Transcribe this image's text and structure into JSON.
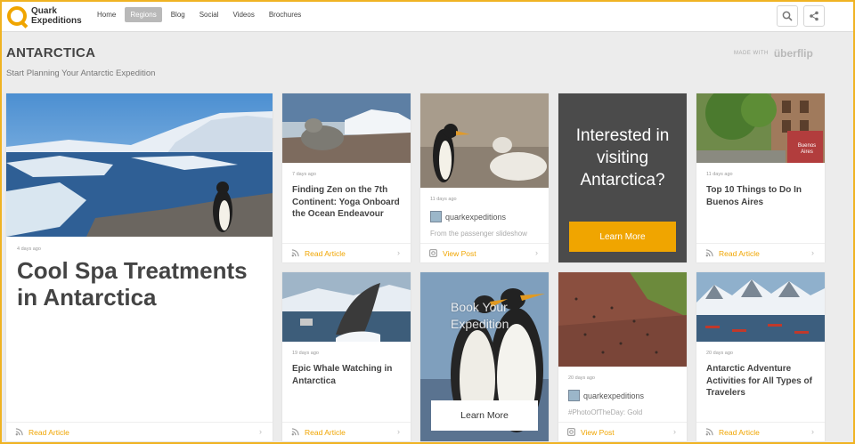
{
  "brand": {
    "name_line1": "Quark",
    "name_line2": "Expeditions"
  },
  "nav": {
    "items": [
      {
        "label": "Home",
        "active": false
      },
      {
        "label": "Regions",
        "active": true
      },
      {
        "label": "Blog",
        "active": false
      },
      {
        "label": "Social",
        "active": false
      },
      {
        "label": "Videos",
        "active": false
      },
      {
        "label": "Brochures",
        "active": false
      }
    ],
    "search_icon": "search-icon",
    "share_icon": "share-icon"
  },
  "header": {
    "title": "ANTARCTICA",
    "subtitle": "Start Planning Your Antarctic Expedition",
    "made_with": "MADE WITH",
    "made_with_brand": "überflip"
  },
  "colors": {
    "accent": "#f0a500",
    "frame": "#f0b323",
    "cta_bg": "#4b4b4b"
  },
  "cards": {
    "feature": {
      "date": "4 days ago",
      "title": "Cool Spa Treatments in Antarctica",
      "action": "Read Article"
    },
    "seal": {
      "date": "7 days ago",
      "title": "Finding Zen on the 7th Continent: Yoga Onboard the Ocean Endeavour",
      "action": "Read Article"
    },
    "penguin_social": {
      "date": "11 days ago",
      "user": "quarkexpeditions",
      "snippet": "From the passenger slideshow",
      "action": "View Post"
    },
    "cta": {
      "text": "Interested in visiting Antarctica?",
      "button": "Learn More"
    },
    "buenos_aires": {
      "date": "11 days ago",
      "title": "Top 10 Things to Do In Buenos Aires",
      "action": "Read Article",
      "sign_text": "Buenos Aires"
    },
    "whale": {
      "date": "19 days ago",
      "title": "Epic Whale Watching in Antarctica",
      "action": "Read Article"
    },
    "book": {
      "text": "Book Your Expedition",
      "button": "Learn More"
    },
    "photo_day": {
      "date": "20 days ago",
      "user": "quarkexpeditions",
      "snippet": "#PhotoOfTheDay: Gold",
      "action": "View Post"
    },
    "adventure": {
      "date": "20 days ago",
      "title": "Antarctic Adventure Activities for All Types of Travelers",
      "action": "Read Article"
    }
  }
}
